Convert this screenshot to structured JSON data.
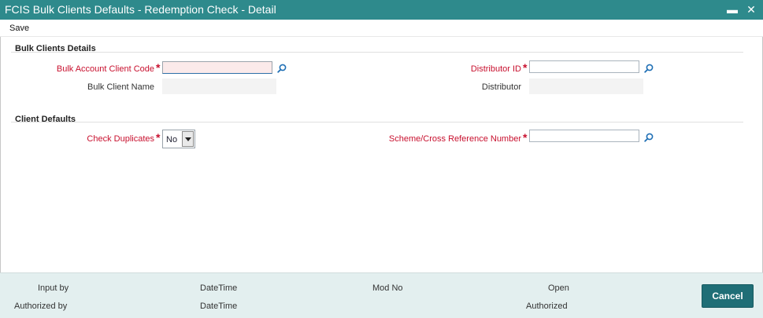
{
  "window": {
    "title": "FCIS Bulk Clients Defaults - Redemption Check - Detail",
    "minimize_glyph": "▬",
    "close_glyph": "✕"
  },
  "menu": {
    "save_label": "Save"
  },
  "sections": {
    "bulk_clients_details": {
      "title": "Bulk Clients Details",
      "bulk_account_client_code": {
        "label": "Bulk Account Client Code",
        "value": ""
      },
      "bulk_client_name": {
        "label": "Bulk Client Name",
        "value": ""
      },
      "distributor_id": {
        "label": "Distributor ID",
        "value": ""
      },
      "distributor": {
        "label": "Distributor",
        "value": ""
      }
    },
    "client_defaults": {
      "title": "Client Defaults",
      "check_duplicates": {
        "label": "Check Duplicates",
        "value": "No"
      },
      "scheme_cross_reference_number": {
        "label": "Scheme/Cross Reference Number",
        "value": ""
      }
    }
  },
  "required_marker": "*",
  "footer": {
    "input_by": "Input by",
    "datetime_1": "DateTime",
    "mod_no": "Mod No",
    "open": "Open",
    "authorized_by": "Authorized by",
    "datetime_2": "DateTime",
    "authorized": "Authorized",
    "cancel_label": "Cancel"
  },
  "icons": {
    "lookup": "search-icon"
  },
  "colors": {
    "titlebar": "#2e8a8c",
    "required_label": "#c8102e",
    "footer_bg": "#e3efef",
    "cancel_button": "#1f6e76"
  }
}
